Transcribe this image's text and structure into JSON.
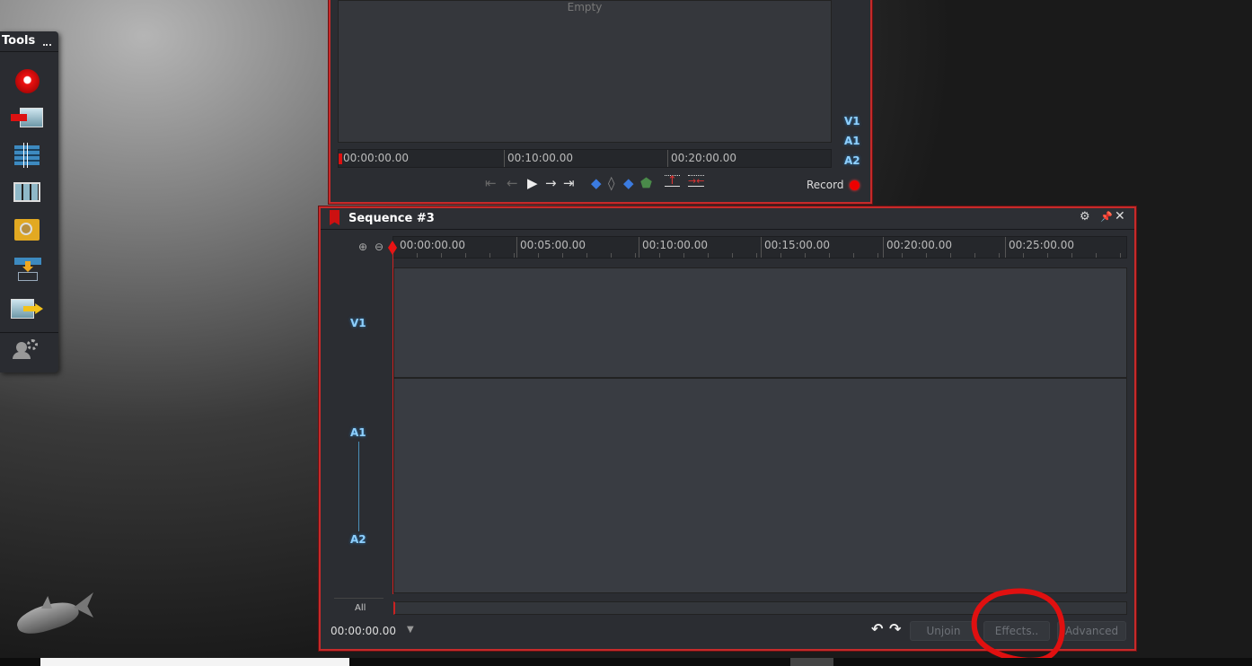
{
  "tools": {
    "title": "Tools",
    "items": [
      "record",
      "import",
      "sequence",
      "gallery",
      "search",
      "export-to-timeline",
      "export",
      "users-settings"
    ]
  },
  "viewer": {
    "empty_label": "Empty",
    "ruler": [
      "00:00:00.00",
      "00:10:00.00",
      "00:20:00.00"
    ],
    "tracks": [
      "V1",
      "A1",
      "A2"
    ],
    "record_label": "Record"
  },
  "sequence": {
    "title": "Sequence #3",
    "ruler": [
      "00:00:00.00",
      "00:05:00.00",
      "00:10:00.00",
      "00:15:00.00",
      "00:20:00.00",
      "00:25:00.00"
    ],
    "tracks": [
      "V1",
      "A1",
      "A2"
    ],
    "all_label": "All",
    "timecode": "00:00:00.00",
    "buttons": {
      "unjoin": "Unjoin",
      "effects": "Effects..",
      "advanced": "Advanced"
    }
  },
  "colors": {
    "accent": "#c62a2a",
    "track_label": "#8fd0ff"
  }
}
